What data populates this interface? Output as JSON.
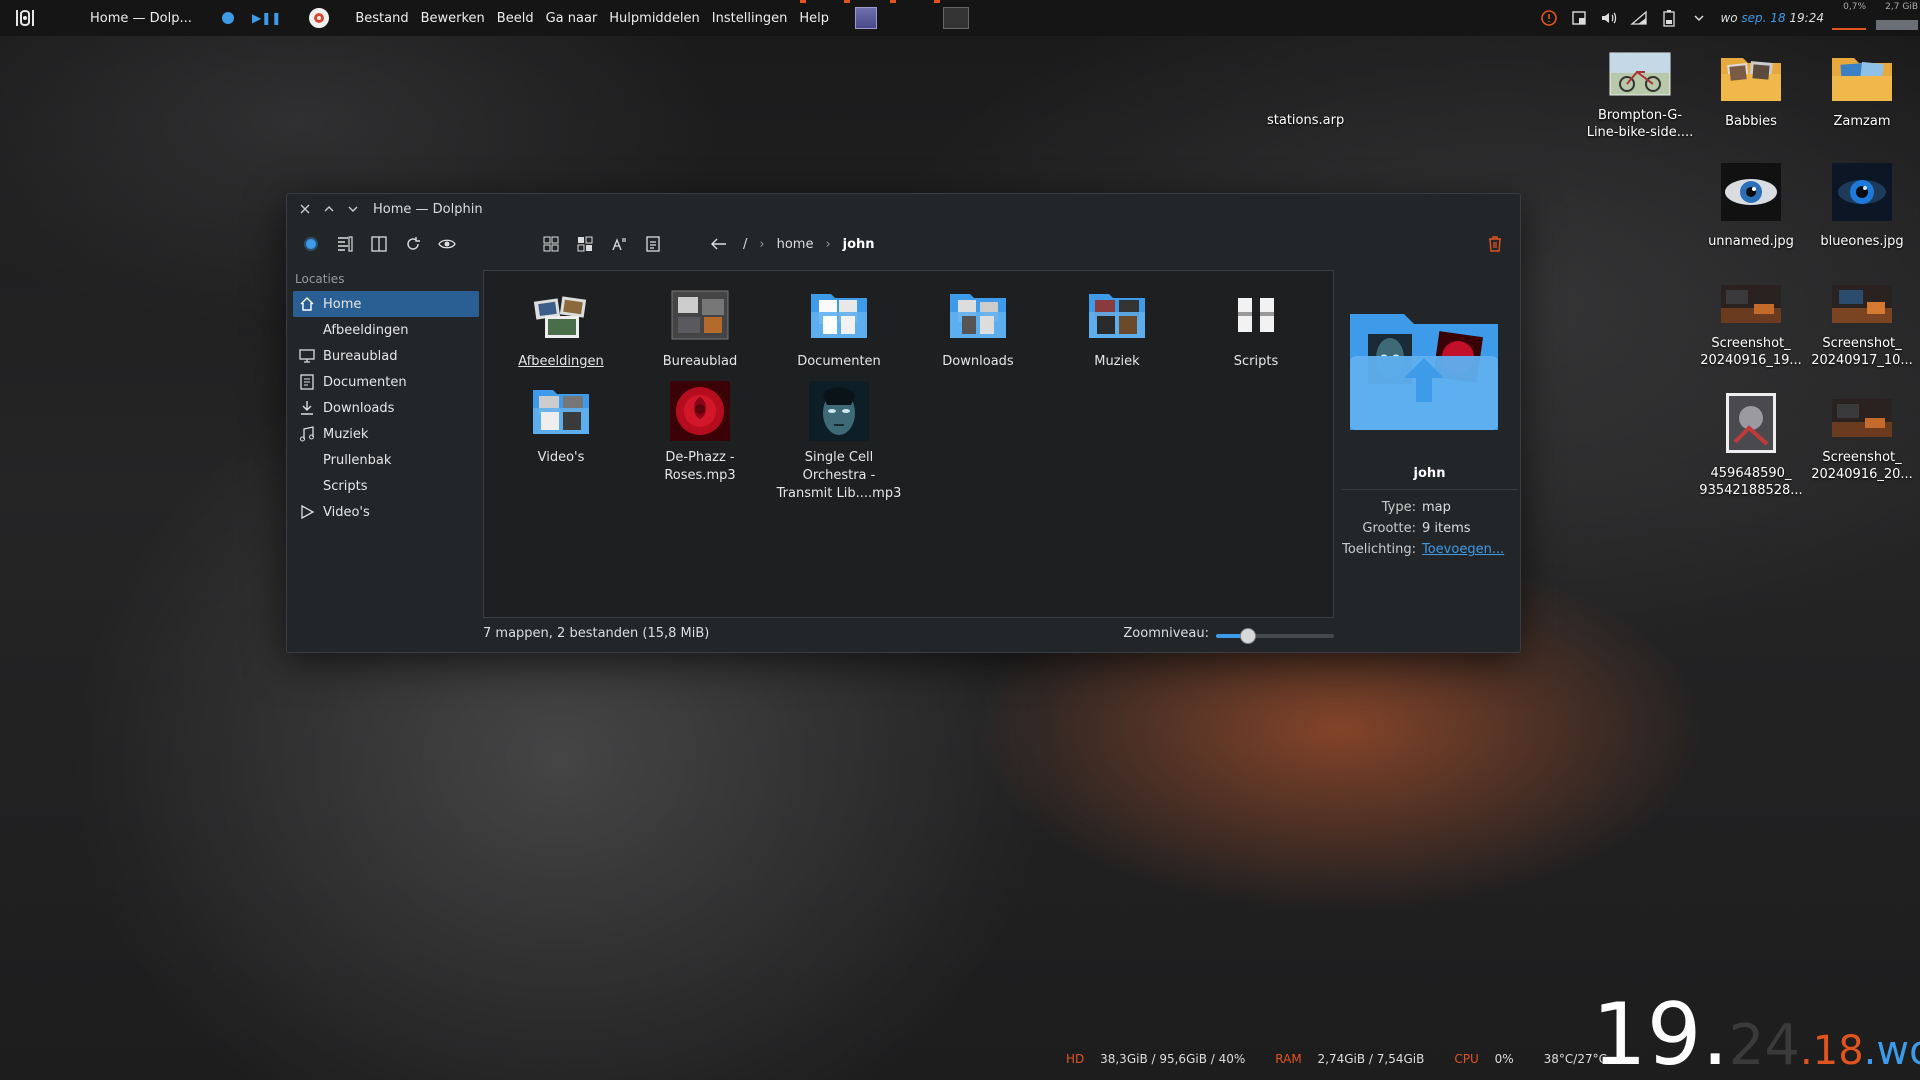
{
  "panel": {
    "task_title": "Home — Dolp...",
    "menu": [
      "Bestand",
      "Bewerken",
      "Beeld",
      "Ga naar",
      "Hulpmiddelen",
      "Instellingen",
      "Help"
    ],
    "clock_day": "wo",
    "clock_date": "sep. 18",
    "clock_time": "19:24",
    "cpu_meter": "0,7%",
    "ram_meter": "2,7 GiB",
    "accent": "#3d9be9",
    "warn": "#e0541f"
  },
  "desktop": {
    "loose_file": "stations.arp",
    "icons": [
      {
        "label": "Brompton-G-Line-bike-side....",
        "icon": "photo-bike"
      },
      {
        "label": "Babbies",
        "icon": "folder-photos"
      },
      {
        "label": "Zamzam",
        "icon": "folder-photos"
      },
      {
        "label": "unnamed.jpg",
        "icon": "eye-photo"
      },
      {
        "label": "blueones.jpg",
        "icon": "eye-photo"
      },
      {
        "label": "Screenshot_ 20240916_19...",
        "icon": "screenshot"
      },
      {
        "label": "Screenshot_ 20240917_10...",
        "icon": "screenshot"
      },
      {
        "label": "459648590_ 93542188528...",
        "icon": "photo"
      },
      {
        "label": "Screenshot_ 20240916_20...",
        "icon": "screenshot"
      }
    ]
  },
  "window": {
    "title": "Home — Dolphin",
    "breadcrumb": {
      "root": "/",
      "parts": [
        "home",
        "john"
      ]
    },
    "sidebar": {
      "heading": "Locaties",
      "items": [
        {
          "label": "Home",
          "icon": "home-icon",
          "active": true
        },
        {
          "label": "Afbeeldingen",
          "icon": "",
          "active": false
        },
        {
          "label": "Bureaublad",
          "icon": "monitor-icon",
          "active": false
        },
        {
          "label": "Documenten",
          "icon": "document-icon",
          "active": false
        },
        {
          "label": "Downloads",
          "icon": "download-icon",
          "active": false
        },
        {
          "label": "Muziek",
          "icon": "music-icon",
          "active": false
        },
        {
          "label": "Prullenbak",
          "icon": "",
          "active": false
        },
        {
          "label": "Scripts",
          "icon": "",
          "active": false
        },
        {
          "label": "Video's",
          "icon": "play-icon",
          "active": false
        }
      ]
    },
    "files": [
      {
        "label": "Afbeeldingen",
        "kind": "folder-images"
      },
      {
        "label": "Bureaublad",
        "kind": "folder-desktop"
      },
      {
        "label": "Documenten",
        "kind": "folder-documents"
      },
      {
        "label": "Downloads",
        "kind": "folder-downloads"
      },
      {
        "label": "Muziek",
        "kind": "folder-music"
      },
      {
        "label": "Scripts",
        "kind": "folder-scripts"
      },
      {
        "label": "Video's",
        "kind": "folder-videos"
      },
      {
        "label": "De-Phazz - Roses.mp3",
        "kind": "audio-rose"
      },
      {
        "label": "Single Cell Orchestra - Transmit Lib....mp3",
        "kind": "audio-face"
      }
    ],
    "info": {
      "name": "john",
      "type_key": "Type:",
      "type_val": "map",
      "size_key": "Grootte:",
      "size_val": "9 items",
      "comment_key": "Toelichting:",
      "comment_val": "Toevoegen..."
    },
    "status": "7 mappen, 2 bestanden (15,8 MiB)",
    "zoom_label": "Zoomniveau:",
    "zoom_level": 0.27
  },
  "stats": {
    "hd_label": "HD",
    "hd_val": "38,3GiB / 95,6GiB / 40%",
    "ram_label": "RAM",
    "ram_val": "2,74GiB / 7,54GiB",
    "cpu_label": "CPU",
    "cpu_val": "0%",
    "temp_val": "38°C/27°C"
  },
  "bigclock": {
    "hour": "19",
    "dot": ".",
    "min": "24",
    "dot2": ".",
    "day": "18",
    "dot3": ".",
    "weekday": "wo"
  }
}
